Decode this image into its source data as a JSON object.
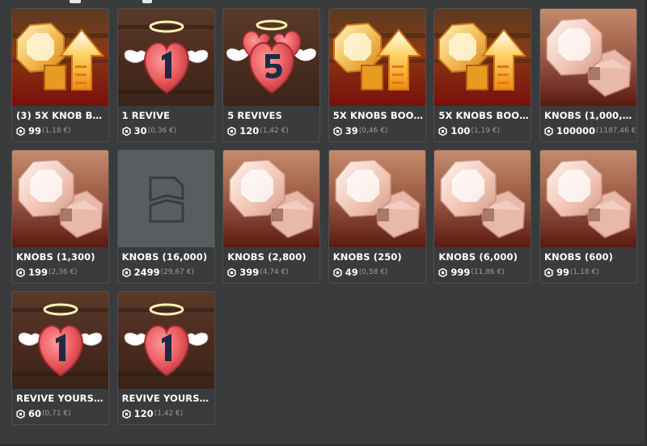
{
  "items": [
    {
      "name": "(3) 5X KNOB BO...",
      "price": "99",
      "eur": "(1,18 €)",
      "image": "knob-boost"
    },
    {
      "name": "1 REVIVE",
      "price": "30",
      "eur": "(0,36 €)",
      "image": "revive-1"
    },
    {
      "name": "5 REVIVES",
      "price": "120",
      "eur": "(1,42 €)",
      "image": "revive-5"
    },
    {
      "name": "5X KNOBS BOOS...",
      "price": "39",
      "eur": "(0,46 €)",
      "image": "knob-boost"
    },
    {
      "name": "5X KNOBS BOOS...",
      "price": "100",
      "eur": "(1,19 €)",
      "image": "knob-boost"
    },
    {
      "name": "KNOBS (1,000,00...",
      "price": "100000",
      "eur": "(1187,46 €)",
      "image": "knob"
    },
    {
      "name": "KNOBS (1,300)",
      "price": "199",
      "eur": "(2,36 €)",
      "image": "knob"
    },
    {
      "name": "KNOBS (16,000)",
      "price": "2499",
      "eur": "(29,67 €)",
      "image": "placeholder"
    },
    {
      "name": "KNOBS (2,800)",
      "price": "399",
      "eur": "(4,74 €)",
      "image": "knob"
    },
    {
      "name": "KNOBS (250)",
      "price": "49",
      "eur": "(0,58 €)",
      "image": "knob"
    },
    {
      "name": "KNOBS (6,000)",
      "price": "999",
      "eur": "(11,86 €)",
      "image": "knob"
    },
    {
      "name": "KNOBS (600)",
      "price": "99",
      "eur": "(1,18 €)",
      "image": "knob"
    },
    {
      "name": "REVIVE YOURSE...",
      "price": "60",
      "eur": "(0,71 €)",
      "image": "revive-1"
    },
    {
      "name": "REVIVE YOURSE...",
      "price": "120",
      "eur": "(1,42 €)",
      "image": "revive-1"
    }
  ],
  "icons": {
    "currency": "robux-icon",
    "placeholder": "broken-image-icon"
  },
  "colors": {
    "background": "#393b3d",
    "card_border": "#4d5053",
    "text": "#ffffff",
    "muted": "#9a9c9e"
  }
}
